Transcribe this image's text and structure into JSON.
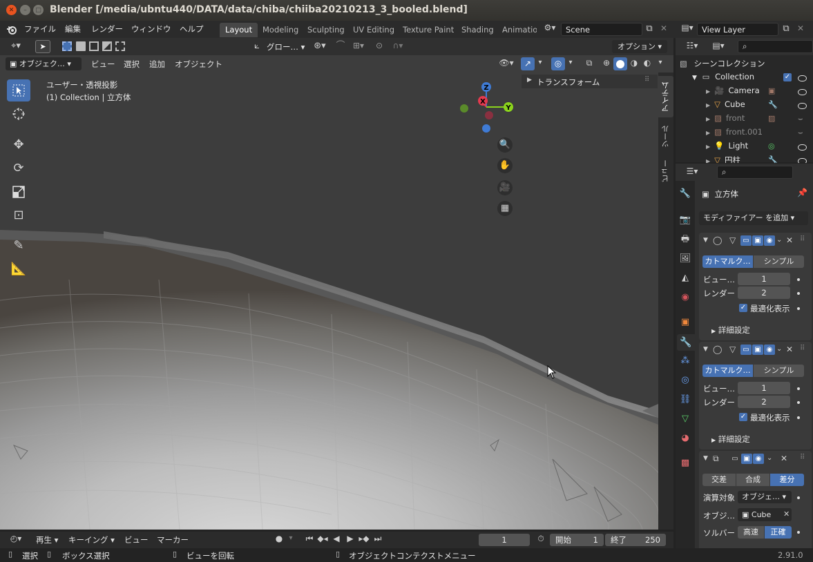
{
  "window": {
    "title": "Blender [/media/ubntu440/DATA/data/chiba/chiiba20210213_3_booled.blend]"
  },
  "menu": {
    "items": [
      "ファイル",
      "編集",
      "レンダー",
      "ウィンドウ",
      "ヘルプ"
    ]
  },
  "workspaces": {
    "tabs": [
      "Layout",
      "Modeling",
      "Sculpting",
      "UV Editing",
      "Texture Paint",
      "Shading",
      "Animatio"
    ],
    "active": "Layout"
  },
  "scene": {
    "name": "Scene"
  },
  "viewlayer": {
    "name": "View Layer"
  },
  "viewport_header": {
    "transform_orientation": "グロー…",
    "options_label": "オプション"
  },
  "viewport_header2": {
    "mode": "オブジェク…",
    "menus": [
      "ビュー",
      "選択",
      "追加",
      "オブジェクト"
    ]
  },
  "viewport": {
    "projection_label": "ユーザー・透視投影",
    "collection_label": "(1) Collection | 立方体",
    "sidebar_panel": "トランスフォーム",
    "sidebar_tabs": [
      "アイテム",
      "ツール",
      "ビュー"
    ]
  },
  "gizmo": {
    "z": "Z",
    "x": "X",
    "y": "Y"
  },
  "outliner": {
    "scene_collection": "シーンコレクション",
    "collection": "Collection",
    "items": [
      {
        "name": "Camera",
        "color": "#e8a54a"
      },
      {
        "name": "Cube",
        "color": "#e8a54a"
      },
      {
        "name": "front",
        "color": "#a07868"
      },
      {
        "name": "front.001",
        "color": "#a07868"
      },
      {
        "name": "Light",
        "color": "#e8a54a"
      },
      {
        "name": "円柱",
        "color": "#e8a54a"
      }
    ]
  },
  "properties": {
    "object_name": "立方体",
    "add_modifier": "モディファイアー を追加",
    "subsurf": [
      {
        "type_a": "カトマルク…",
        "type_b": "シンプル",
        "viewport_label": "ビュー…",
        "viewport_value": "1",
        "render_label": "レンダー",
        "render_value": "2",
        "optimal_label": "最適化表示",
        "advanced_label": "詳細設定"
      },
      {
        "type_a": "カトマルク…",
        "type_b": "シンプル",
        "viewport_label": "ビュー…",
        "viewport_value": "1",
        "render_label": "レンダー",
        "render_value": "2",
        "optimal_label": "最適化表示",
        "advanced_label": "詳細設定"
      }
    ],
    "boolean": {
      "ops": [
        "交差",
        "合成",
        "差分"
      ],
      "active_op": "差分",
      "operand_label": "演算対象",
      "operand_value": "オブジェ…",
      "object_label": "オブジ…",
      "object_value": "Cube",
      "solver_label": "ソルバー",
      "solver_fast": "高速",
      "solver_exact": "正確"
    }
  },
  "timeline": {
    "play_menu": "再生",
    "keying_menu": "キーイング",
    "view_menu": "ビュー",
    "marker_menu": "マーカー",
    "current_frame": "1",
    "start_label": "開始",
    "start_value": "1",
    "end_label": "終了",
    "end_value": "250"
  },
  "statusbar": {
    "select": "選択",
    "box_select": "ボックス選択",
    "rotate_view": "ビューを回転",
    "context_menu": "オブジェクトコンテクストメニュー",
    "version": "2.91.0"
  },
  "colors": {
    "accent": "#4772b3",
    "axis_x": "#e4394e",
    "axis_y": "#8bd41c",
    "axis_z": "#3f7bd5"
  }
}
